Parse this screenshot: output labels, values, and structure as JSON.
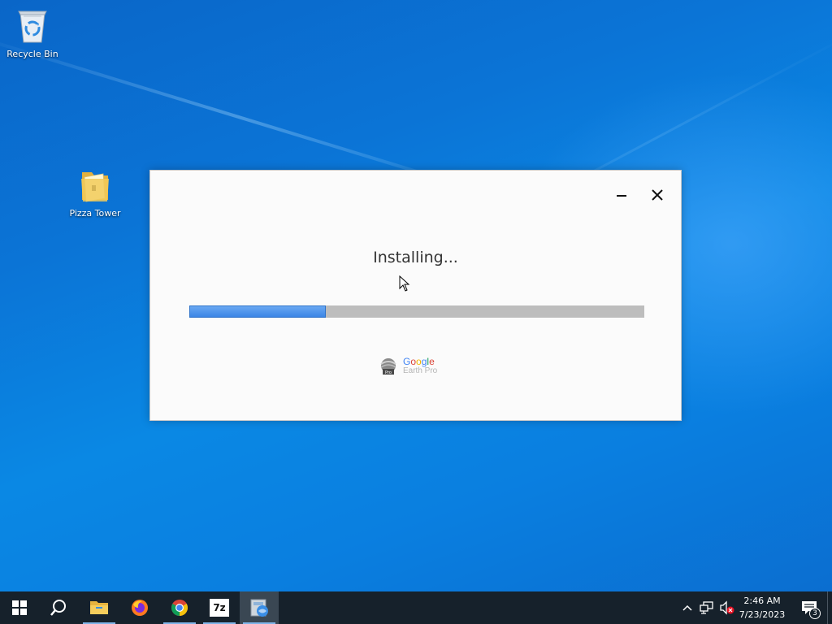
{
  "desktop": {
    "icons": [
      {
        "label": "Recycle Bin",
        "icon": "recycle-bin-icon"
      },
      {
        "label": "Pizza Tower",
        "icon": "folder-icon"
      }
    ]
  },
  "installer": {
    "status_text": "Installing...",
    "progress_fraction": 0.3,
    "brand": {
      "google": "Google",
      "product": "Earth Pro",
      "logo_badge": "Pro"
    },
    "accent_color": "#3a85e6"
  },
  "taskbar": {
    "buttons": [
      {
        "name": "start",
        "icon": "windows-logo-icon"
      },
      {
        "name": "search",
        "icon": "search-icon"
      },
      {
        "name": "file-explorer",
        "icon": "folder-icon"
      },
      {
        "name": "firefox",
        "icon": "firefox-icon"
      },
      {
        "name": "chrome",
        "icon": "chrome-icon"
      },
      {
        "name": "7zip",
        "icon": "7zip-icon",
        "text": "7z"
      },
      {
        "name": "installer",
        "icon": "installer-icon"
      }
    ],
    "tray": {
      "time": "2:46 AM",
      "date": "7/23/2023",
      "notification_count": "3"
    }
  }
}
